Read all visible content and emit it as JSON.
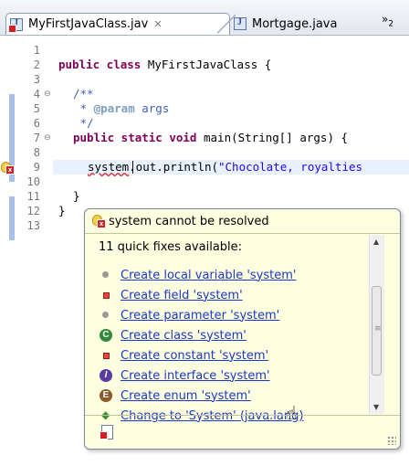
{
  "tabs": [
    {
      "label": "MyFirstJavaClass.jav",
      "close": "✕",
      "has_error": true,
      "active": true
    },
    {
      "label": "Mortgage.java",
      "active": false
    }
  ],
  "tab_overflow": {
    "symbol": "»",
    "count": "2"
  },
  "line_numbers": [
    "1",
    "2",
    "3",
    "4",
    "5",
    "6",
    "7",
    "8",
    "9",
    "10",
    "11",
    "12",
    "13"
  ],
  "code": {
    "line2_kw": "public class ",
    "line2_rest": "MyFirstJavaClass {",
    "line4": "/**",
    "line5_prefix": " * ",
    "line5_tag": "@param",
    "line5_rest": " args",
    "line6": " */",
    "line7_kw": "public static void ",
    "line7_rest": "main(String[] args) {",
    "line8_err": "system",
    "line8_rest": ".out.println(",
    "line8_str": "\"Chocolate, royalties",
    "line10": "}",
    "line12": "}"
  },
  "popup": {
    "header": "system cannot be resolved",
    "count": "11 quick fixes available:",
    "fixes": [
      {
        "label": "Create local variable 'system'",
        "icon": "local-variable-icon"
      },
      {
        "label": "Create field 'system'",
        "icon": "field-icon"
      },
      {
        "label": "Create parameter 'system'",
        "icon": "parameter-icon"
      },
      {
        "label": "Create class 'system'",
        "icon": "class-icon",
        "glyph": "C"
      },
      {
        "label": "Create constant 'system'",
        "icon": "constant-icon"
      },
      {
        "label": "Create interface 'system'",
        "icon": "interface-icon",
        "glyph": "I"
      },
      {
        "label": "Create enum 'system'",
        "icon": "enum-icon",
        "glyph": "E"
      },
      {
        "label": "Change to 'System' (java.lang)",
        "icon": "change-icon"
      }
    ]
  },
  "colors": {
    "keyword": "#7f0055",
    "javadoc": "#3f5fbf",
    "string": "#2a00ff",
    "link": "#1a39c4",
    "popup_bg": "#fefee1"
  }
}
